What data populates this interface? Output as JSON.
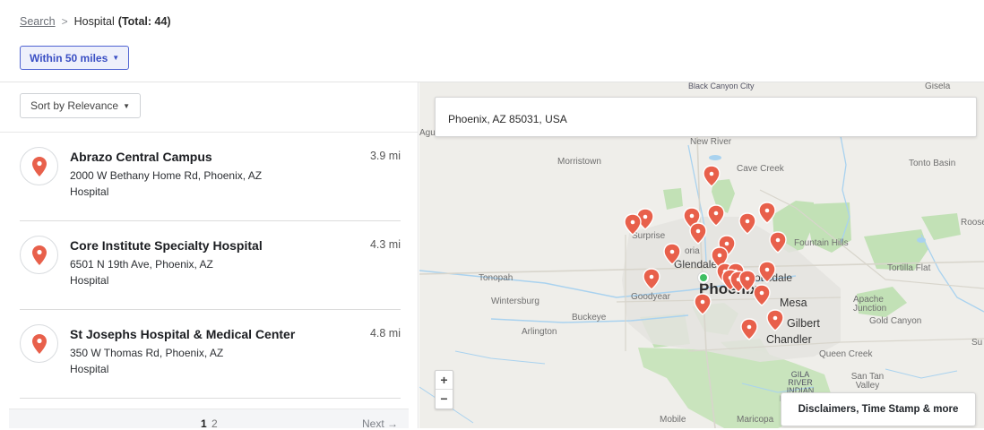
{
  "breadcrumb": {
    "link": "Search",
    "separator": ">",
    "current": "Hospital",
    "total": "(Total: 44)"
  },
  "filter": {
    "label": "Within 50 miles"
  },
  "sort": {
    "label": "Sort by Relevance"
  },
  "results": [
    {
      "name": "Abrazo Central Campus",
      "address": "2000 W Bethany Home Rd, Phoenix, AZ",
      "type": "Hospital",
      "distance": "3.9 mi"
    },
    {
      "name": "Core Institute Specialty Hospital",
      "address": "6501 N 19th Ave, Phoenix, AZ",
      "type": "Hospital",
      "distance": "4.3 mi"
    },
    {
      "name": "St Josephs Hospital & Medical Center",
      "address": "350 W Thomas Rd, Phoenix, AZ",
      "type": "Hospital",
      "distance": "4.8 mi"
    }
  ],
  "pagination": {
    "page1": "1",
    "page2": "2",
    "next": "Next →"
  },
  "map": {
    "search_value": "Phoenix, AZ 85031, USA",
    "zoom_in": "+",
    "zoom_out": "−",
    "disclaimer": "Disclaimers, Time Stamp & more",
    "labels": {
      "black_canyon": "Black Canyon City",
      "gisela": "Gisela",
      "agu": "Agu",
      "new_river": "New River",
      "morristown": "Morristown",
      "cave_creek": "Cave Creek",
      "tonto_basin": "Tonto Basin",
      "roose": "Roose",
      "surprise": "Surprise",
      "peoria": "oria",
      "fountain_hills": "Fountain Hills",
      "glendale": "Glendale",
      "scottsdale": "ottsdale",
      "tortilla_flat": "Tortilla Flat",
      "tonopah": "Tonopah",
      "wintersburg": "Wintersburg",
      "goodyear": "Goodyear",
      "phoenix": "Phoenix",
      "mesa": "Mesa",
      "apache_junction": "Apache Junction",
      "buckeye": "Buckeye",
      "gilbert": "Gilbert",
      "gold_canyon": "Gold Canyon",
      "arlington": "Arlington",
      "chandler": "Chandler",
      "su": "Su",
      "queen_creek": "Queen Creek",
      "gila_river": "GILA RIVER INDIAN RESERVATION",
      "san_tan_valley": "San Tan Valley",
      "mobile": "Mobile",
      "maricopa": "Maricopa"
    },
    "colors": {
      "marker": "#e8604b",
      "park": "#c2e1b6",
      "water": "#a9d2ef",
      "user": "#3fbf63"
    }
  }
}
